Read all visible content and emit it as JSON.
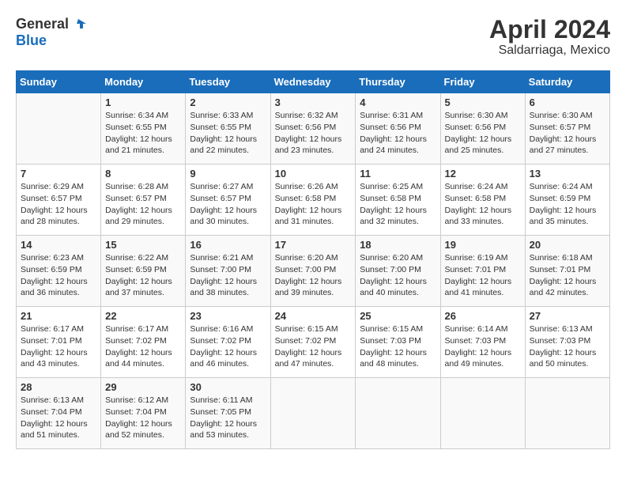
{
  "header": {
    "logo_general": "General",
    "logo_blue": "Blue",
    "title": "April 2024",
    "subtitle": "Saldarriaga, Mexico"
  },
  "calendar": {
    "days": [
      "Sunday",
      "Monday",
      "Tuesday",
      "Wednesday",
      "Thursday",
      "Friday",
      "Saturday"
    ],
    "weeks": [
      [
        {
          "date": "",
          "info": ""
        },
        {
          "date": "1",
          "info": "Sunrise: 6:34 AM\nSunset: 6:55 PM\nDaylight: 12 hours\nand 21 minutes."
        },
        {
          "date": "2",
          "info": "Sunrise: 6:33 AM\nSunset: 6:55 PM\nDaylight: 12 hours\nand 22 minutes."
        },
        {
          "date": "3",
          "info": "Sunrise: 6:32 AM\nSunset: 6:56 PM\nDaylight: 12 hours\nand 23 minutes."
        },
        {
          "date": "4",
          "info": "Sunrise: 6:31 AM\nSunset: 6:56 PM\nDaylight: 12 hours\nand 24 minutes."
        },
        {
          "date": "5",
          "info": "Sunrise: 6:30 AM\nSunset: 6:56 PM\nDaylight: 12 hours\nand 25 minutes."
        },
        {
          "date": "6",
          "info": "Sunrise: 6:30 AM\nSunset: 6:57 PM\nDaylight: 12 hours\nand 27 minutes."
        }
      ],
      [
        {
          "date": "7",
          "info": "Sunrise: 6:29 AM\nSunset: 6:57 PM\nDaylight: 12 hours\nand 28 minutes."
        },
        {
          "date": "8",
          "info": "Sunrise: 6:28 AM\nSunset: 6:57 PM\nDaylight: 12 hours\nand 29 minutes."
        },
        {
          "date": "9",
          "info": "Sunrise: 6:27 AM\nSunset: 6:57 PM\nDaylight: 12 hours\nand 30 minutes."
        },
        {
          "date": "10",
          "info": "Sunrise: 6:26 AM\nSunset: 6:58 PM\nDaylight: 12 hours\nand 31 minutes."
        },
        {
          "date": "11",
          "info": "Sunrise: 6:25 AM\nSunset: 6:58 PM\nDaylight: 12 hours\nand 32 minutes."
        },
        {
          "date": "12",
          "info": "Sunrise: 6:24 AM\nSunset: 6:58 PM\nDaylight: 12 hours\nand 33 minutes."
        },
        {
          "date": "13",
          "info": "Sunrise: 6:24 AM\nSunset: 6:59 PM\nDaylight: 12 hours\nand 35 minutes."
        }
      ],
      [
        {
          "date": "14",
          "info": "Sunrise: 6:23 AM\nSunset: 6:59 PM\nDaylight: 12 hours\nand 36 minutes."
        },
        {
          "date": "15",
          "info": "Sunrise: 6:22 AM\nSunset: 6:59 PM\nDaylight: 12 hours\nand 37 minutes."
        },
        {
          "date": "16",
          "info": "Sunrise: 6:21 AM\nSunset: 7:00 PM\nDaylight: 12 hours\nand 38 minutes."
        },
        {
          "date": "17",
          "info": "Sunrise: 6:20 AM\nSunset: 7:00 PM\nDaylight: 12 hours\nand 39 minutes."
        },
        {
          "date": "18",
          "info": "Sunrise: 6:20 AM\nSunset: 7:00 PM\nDaylight: 12 hours\nand 40 minutes."
        },
        {
          "date": "19",
          "info": "Sunrise: 6:19 AM\nSunset: 7:01 PM\nDaylight: 12 hours\nand 41 minutes."
        },
        {
          "date": "20",
          "info": "Sunrise: 6:18 AM\nSunset: 7:01 PM\nDaylight: 12 hours\nand 42 minutes."
        }
      ],
      [
        {
          "date": "21",
          "info": "Sunrise: 6:17 AM\nSunset: 7:01 PM\nDaylight: 12 hours\nand 43 minutes."
        },
        {
          "date": "22",
          "info": "Sunrise: 6:17 AM\nSunset: 7:02 PM\nDaylight: 12 hours\nand 44 minutes."
        },
        {
          "date": "23",
          "info": "Sunrise: 6:16 AM\nSunset: 7:02 PM\nDaylight: 12 hours\nand 46 minutes."
        },
        {
          "date": "24",
          "info": "Sunrise: 6:15 AM\nSunset: 7:02 PM\nDaylight: 12 hours\nand 47 minutes."
        },
        {
          "date": "25",
          "info": "Sunrise: 6:15 AM\nSunset: 7:03 PM\nDaylight: 12 hours\nand 48 minutes."
        },
        {
          "date": "26",
          "info": "Sunrise: 6:14 AM\nSunset: 7:03 PM\nDaylight: 12 hours\nand 49 minutes."
        },
        {
          "date": "27",
          "info": "Sunrise: 6:13 AM\nSunset: 7:03 PM\nDaylight: 12 hours\nand 50 minutes."
        }
      ],
      [
        {
          "date": "28",
          "info": "Sunrise: 6:13 AM\nSunset: 7:04 PM\nDaylight: 12 hours\nand 51 minutes."
        },
        {
          "date": "29",
          "info": "Sunrise: 6:12 AM\nSunset: 7:04 PM\nDaylight: 12 hours\nand 52 minutes."
        },
        {
          "date": "30",
          "info": "Sunrise: 6:11 AM\nSunset: 7:05 PM\nDaylight: 12 hours\nand 53 minutes."
        },
        {
          "date": "",
          "info": ""
        },
        {
          "date": "",
          "info": ""
        },
        {
          "date": "",
          "info": ""
        },
        {
          "date": "",
          "info": ""
        }
      ]
    ]
  }
}
